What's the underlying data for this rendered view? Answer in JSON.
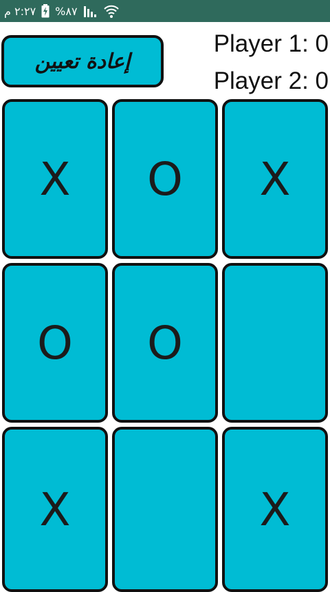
{
  "status_bar": {
    "time": "٢:٢٧ م",
    "battery_percent": "%٨٧",
    "icons": [
      "battery-charging-icon",
      "signal-icon",
      "wifi-icon"
    ]
  },
  "header": {
    "reset_label": "إعادة تعيين",
    "player1_score": "Player 1: 0",
    "player2_score": "Player 2: 0"
  },
  "board": {
    "cells": [
      [
        "X",
        "O",
        "X"
      ],
      [
        "O",
        "O",
        ""
      ],
      [
        "X",
        "",
        "X"
      ]
    ]
  },
  "colors": {
    "status_bar": "#2f6a5c",
    "cell_fill": "#00bcd4",
    "border": "#111111",
    "mark": "#1b1b1b"
  }
}
